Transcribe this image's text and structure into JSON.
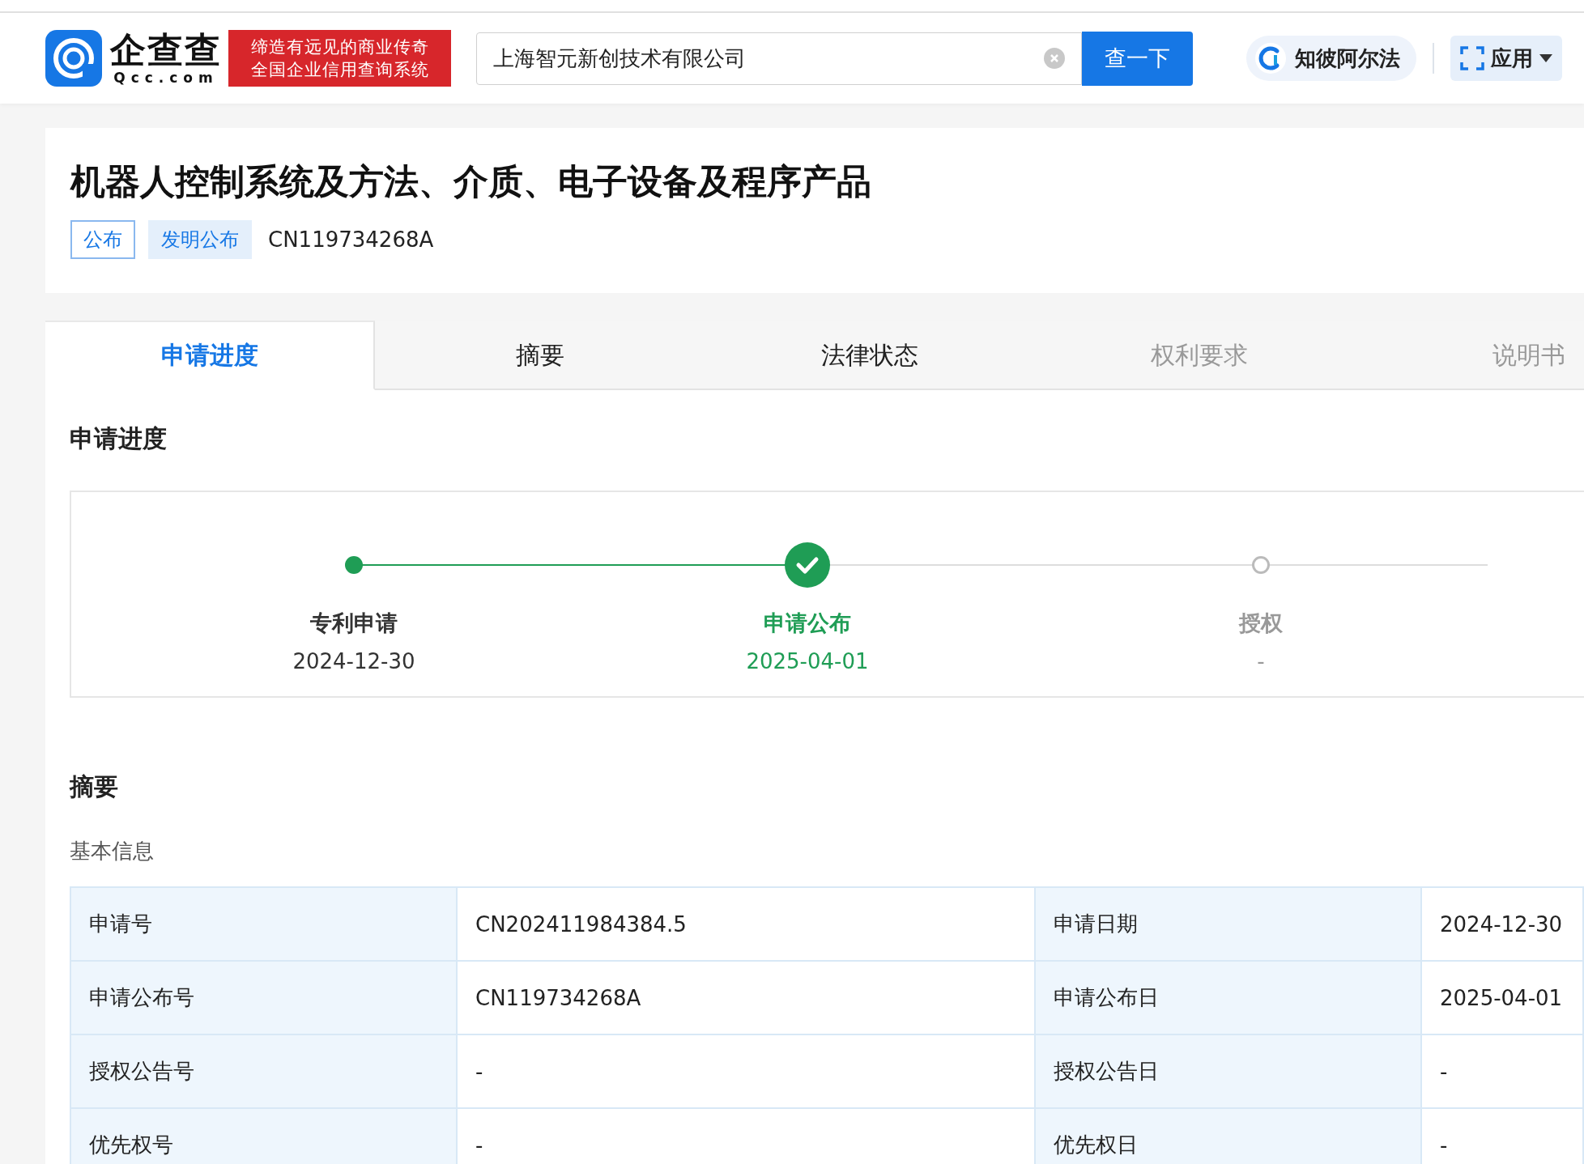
{
  "header": {
    "logo": {
      "name": "企查查",
      "domain": "Qcc.com"
    },
    "slogan": [
      "缔造有远见的商业传奇",
      "全国企业信用查询系统"
    ],
    "search": {
      "value": "上海智元新创技术有限公司",
      "button": "查一下"
    },
    "alpha_button": "知彼阿尔法",
    "apps_button": "应用"
  },
  "patent": {
    "title": "机器人控制系统及方法、介质、电子设备及程序产品",
    "tags": [
      {
        "label": "公布",
        "kind": "outline"
      },
      {
        "label": "发明公布",
        "kind": "filled"
      }
    ],
    "number": "CN119734268A"
  },
  "tabs": [
    {
      "label": "申请进度",
      "selected": true,
      "disabled": false
    },
    {
      "label": "摘要",
      "selected": false,
      "disabled": false
    },
    {
      "label": "法律状态",
      "selected": false,
      "disabled": false
    },
    {
      "label": "权利要求",
      "selected": false,
      "disabled": true
    },
    {
      "label": "说明书",
      "selected": false,
      "disabled": true
    }
  ],
  "progress": {
    "title": "申请进度",
    "steps": [
      {
        "label": "专利申请",
        "date": "2024-12-30",
        "completed": true,
        "current": false
      },
      {
        "label": "申请公布",
        "date": "2025-04-01",
        "completed": true,
        "current": true
      },
      {
        "label": "授权",
        "date": "-",
        "completed": false,
        "current": false
      }
    ]
  },
  "abstract": {
    "title": "摘要",
    "subtitle": "基本信息",
    "rows": [
      [
        {
          "label": "申请号",
          "value": "CN202411984384.5"
        },
        {
          "label": "申请日期",
          "value": "2024-12-30"
        }
      ],
      [
        {
          "label": "申请公布号",
          "value": "CN119734268A"
        },
        {
          "label": "申请公布日",
          "value": "2025-04-01"
        }
      ],
      [
        {
          "label": "授权公告号",
          "value": "-"
        },
        {
          "label": "授权公告日",
          "value": "-"
        }
      ],
      [
        {
          "label": "优先权号",
          "value": "-"
        },
        {
          "label": "优先权日",
          "value": "-"
        }
      ]
    ]
  }
}
